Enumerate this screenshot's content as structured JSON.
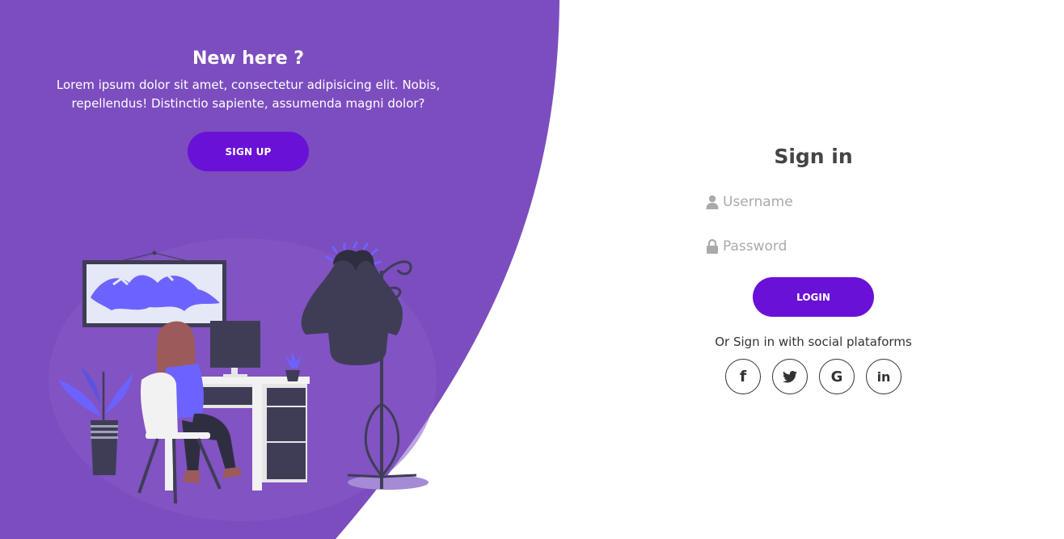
{
  "colors": {
    "panel_purple": "#7c4dbf",
    "accent_button": "#6a11d8",
    "title_dark": "#444444",
    "placeholder_gray": "#aaaaaa",
    "text_dark": "#333333"
  },
  "left_panel": {
    "title": "New here ?",
    "description": "Lorem ipsum dolor sit amet, consectetur adipisicing elit. Nobis, repellendus! Distinctio sapiente, assumenda magni dolor?",
    "signup_label": "Sign up"
  },
  "signin_form": {
    "title": "Sign in",
    "username": {
      "value": "",
      "placeholder": "Username",
      "icon": "user-icon"
    },
    "password": {
      "value": "",
      "placeholder": "Password",
      "icon": "lock-icon"
    },
    "login_label": "Login",
    "social_text": "Or Sign in with social plataforms",
    "social": [
      {
        "name": "facebook",
        "glyph": "f"
      },
      {
        "name": "twitter",
        "glyph": "twitter-bird"
      },
      {
        "name": "google",
        "glyph": "G"
      },
      {
        "name": "linkedin",
        "glyph": "in"
      }
    ]
  }
}
